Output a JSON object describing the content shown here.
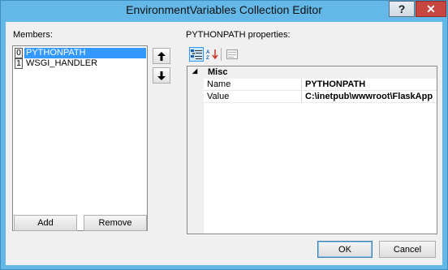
{
  "window": {
    "title": "EnvironmentVariables Collection Editor",
    "help_label": "?",
    "close_label": "✕"
  },
  "members": {
    "label": "Members:",
    "items": [
      {
        "index": "0",
        "name": "PYTHONPATH",
        "selected": true
      },
      {
        "index": "1",
        "name": "WSGI_HANDLER",
        "selected": false
      }
    ],
    "add_label": "Add",
    "remove_label": "Remove",
    "move_up_icon": "arrow-up-icon",
    "move_down_icon": "arrow-down-icon"
  },
  "properties": {
    "label": "PYTHONPATH properties:",
    "toolbar": [
      "categorized-icon",
      "alphabetical-icon",
      "property-pages-icon"
    ],
    "category": "Misc",
    "rows": [
      {
        "name": "Name",
        "value": "PYTHONPATH"
      },
      {
        "name": "Value",
        "value": "C:\\inetpub\\wwwroot\\FlaskApp"
      }
    ]
  },
  "footer": {
    "ok_label": "OK",
    "cancel_label": "Cancel"
  },
  "colors": {
    "frame": "#63b8e8",
    "selection": "#3399ff",
    "close_button": "#c7463f"
  }
}
